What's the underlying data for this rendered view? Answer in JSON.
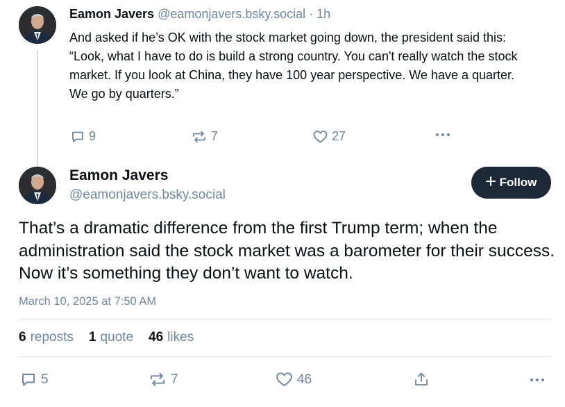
{
  "reply": {
    "author_name": "Eamon Javers",
    "author_handle": "@eamonjavers.bsky.social",
    "time_sep": " · ",
    "time": "1h",
    "text_lines": [
      "And asked if he’s OK with the stock market going down, the president said this:",
      "“Look, what I have to do is build a strong country. You can't really watch the stock market. If you look at China, they have 100 year perspective. We have a quarter. We go by quarters.”"
    ],
    "replies": "9",
    "reposts": "7",
    "likes": "27"
  },
  "post": {
    "author_name": "Eamon Javers",
    "author_handle": "@eamonjavers.bsky.social",
    "follow_label": "Follow",
    "text": "That’s a dramatic difference from the first Trump term; when the administration said the stock market was a barometer for their success. Now it’s something they don’t want to watch.",
    "timestamp": "March 10, 2025 at 7:50 AM",
    "stats": {
      "reposts_count": "6",
      "reposts_label": "reposts",
      "quotes_count": "1",
      "quotes_label": "quote",
      "likes_count": "46",
      "likes_label": "likes"
    },
    "actions": {
      "replies": "5",
      "reposts": "7",
      "likes": "46"
    }
  },
  "icons": {
    "reply": "reply-icon",
    "repost": "repost-icon",
    "like": "heart-icon",
    "share": "share-icon",
    "more": "more-icon",
    "follow": "plus-icon"
  },
  "colors": {
    "muted": "#6f869f",
    "follow_bg": "#1e2937",
    "text": "#0b0f14",
    "divider": "#e0e6ec"
  }
}
